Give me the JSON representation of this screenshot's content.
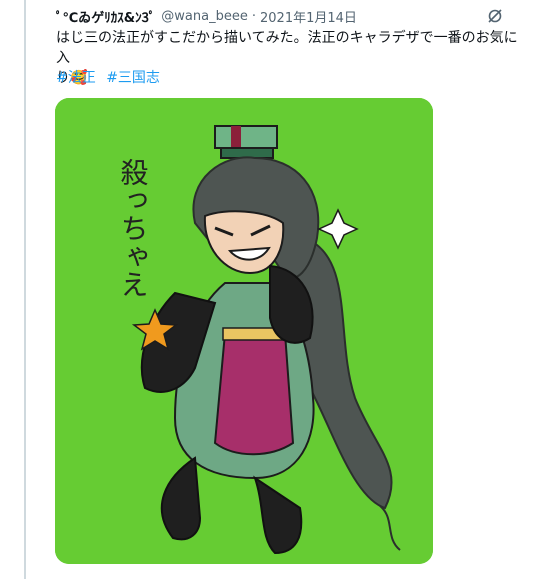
{
  "tweet": {
    "display_name": "ﾟ℃ゐゲﾘｶｽ&ﾝ3ﾟ",
    "handle": "@wana_beee",
    "separator": "·",
    "date": "2021年1月14日",
    "text_line1": "はじ三の法正がすこだから描いてみた。法正のキャラデザで一番のお気に入",
    "text_line2": "り🥰",
    "hashtags": [
      "#法正",
      "#三国志"
    ]
  },
  "media": {
    "drawn_text": "殺っちゃえ",
    "background_color": "#66cc33"
  },
  "icons": {
    "more": "no-eye-icon"
  }
}
